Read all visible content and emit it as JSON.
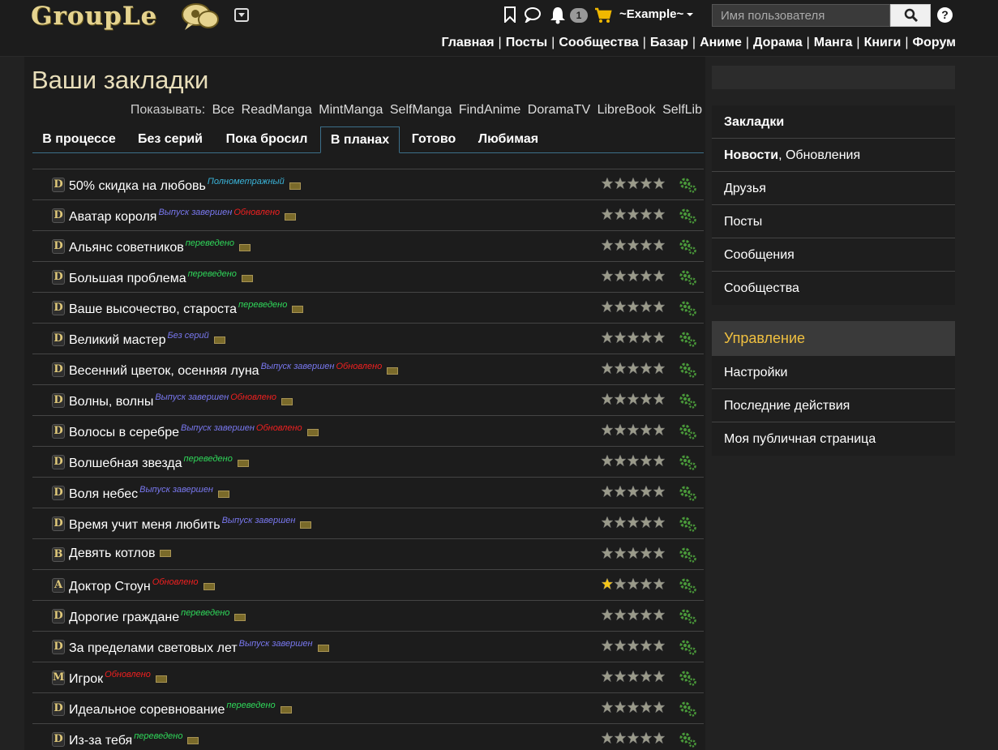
{
  "header": {
    "logo_text": "GroupLe",
    "notifications_count": "1",
    "username": "~Example~",
    "search_placeholder": "Имя пользователя",
    "help_label": "?",
    "nav": [
      "Главная",
      "Посты",
      "Сообщества",
      "Базар",
      "Аниме",
      "Дорама",
      "Манга",
      "Книги",
      "Форум"
    ],
    "nav_separator": "|"
  },
  "page": {
    "title": "Ваши закладки",
    "show_label": "Показывать:",
    "show_options": [
      "Все",
      "ReadManga",
      "MintManga",
      "SelfManga",
      "FindAnime",
      "DoramaTV",
      "LibreBook",
      "SelfLib"
    ],
    "tabs": [
      "В процессе",
      "Без серий",
      "Пока бросил",
      "В планах",
      "Готово",
      "Любимая"
    ],
    "active_tab": "В планах"
  },
  "bookmarks": [
    {
      "type": "D",
      "title": "50% скидка на любовь",
      "tags": [
        {
          "text": "Полнометражный",
          "color": "cyan"
        }
      ],
      "rating": 0
    },
    {
      "type": "D",
      "title": "Аватар короля",
      "tags": [
        {
          "text": "Выпуск завершен",
          "color": "blue"
        },
        {
          "text": "Обновлено",
          "color": "red"
        }
      ],
      "rating": 0
    },
    {
      "type": "D",
      "title": "Альянс советников",
      "tags": [
        {
          "text": "переведено",
          "color": "green"
        }
      ],
      "rating": 0
    },
    {
      "type": "D",
      "title": "Большая проблема",
      "tags": [
        {
          "text": "переведено",
          "color": "green"
        }
      ],
      "rating": 0
    },
    {
      "type": "D",
      "title": "Ваше высочество, староста",
      "tags": [
        {
          "text": "переведено",
          "color": "green"
        }
      ],
      "rating": 0
    },
    {
      "type": "D",
      "title": "Великий мастер",
      "tags": [
        {
          "text": "Без серий",
          "color": "blue"
        }
      ],
      "rating": 0
    },
    {
      "type": "D",
      "title": "Весенний цветок, осенняя луна",
      "tags": [
        {
          "text": "Выпуск завершен",
          "color": "blue"
        },
        {
          "text": "Обновлено",
          "color": "red"
        }
      ],
      "rating": 0
    },
    {
      "type": "D",
      "title": "Волны, волны",
      "tags": [
        {
          "text": "Выпуск завершен",
          "color": "blue"
        },
        {
          "text": "Обновлено",
          "color": "red"
        }
      ],
      "rating": 0
    },
    {
      "type": "D",
      "title": "Волосы в серебре",
      "tags": [
        {
          "text": "Выпуск завершен",
          "color": "blue"
        },
        {
          "text": "Обновлено",
          "color": "red"
        }
      ],
      "rating": 0
    },
    {
      "type": "D",
      "title": "Волшебная звезда",
      "tags": [
        {
          "text": "переведено",
          "color": "green"
        }
      ],
      "rating": 0
    },
    {
      "type": "D",
      "title": "Воля небес",
      "tags": [
        {
          "text": "Выпуск завершен",
          "color": "blue"
        }
      ],
      "rating": 0
    },
    {
      "type": "D",
      "title": "Время учит меня любить",
      "tags": [
        {
          "text": "Выпуск завершен",
          "color": "blue"
        }
      ],
      "rating": 0
    },
    {
      "type": "B",
      "title": "Девять котлов",
      "tags": [],
      "rating": 0
    },
    {
      "type": "A",
      "title": "Доктор Стоун",
      "tags": [
        {
          "text": "Обновлено",
          "color": "red"
        }
      ],
      "rating": 1
    },
    {
      "type": "D",
      "title": "Дорогие граждане",
      "tags": [
        {
          "text": "переведено",
          "color": "green"
        }
      ],
      "rating": 0
    },
    {
      "type": "D",
      "title": "За пределами световых лет",
      "tags": [
        {
          "text": "Выпуск завершен",
          "color": "blue"
        }
      ],
      "rating": 0
    },
    {
      "type": "M",
      "title": "Игрок",
      "tags": [
        {
          "text": "Обновлено",
          "color": "red"
        }
      ],
      "rating": 0
    },
    {
      "type": "D",
      "title": "Идеальное соревнование",
      "tags": [
        {
          "text": "переведено",
          "color": "green"
        }
      ],
      "rating": 0
    },
    {
      "type": "D",
      "title": "Из-за тебя",
      "tags": [
        {
          "text": "переведено",
          "color": "green"
        }
      ],
      "rating": 0
    }
  ],
  "sidebar": {
    "items": [
      {
        "label": "Закладки",
        "bold": true
      },
      {
        "label": "Новости",
        "bold": true,
        "suffix": ", Обновления"
      },
      {
        "label": "Друзья",
        "bold": false
      },
      {
        "label": "Посты",
        "bold": false
      },
      {
        "label": "Сообщения",
        "bold": false
      },
      {
        "label": "Сообщества",
        "bold": false
      }
    ],
    "management_title": "Управление",
    "management_items": [
      "Настройки",
      "Последние действия",
      "Моя публичная страница"
    ]
  },
  "colors": {
    "accent": "#f0c040",
    "star_gray": "#9a9a8a",
    "star_gold": "#f5c518",
    "gear_green": "#4a9a3a"
  }
}
